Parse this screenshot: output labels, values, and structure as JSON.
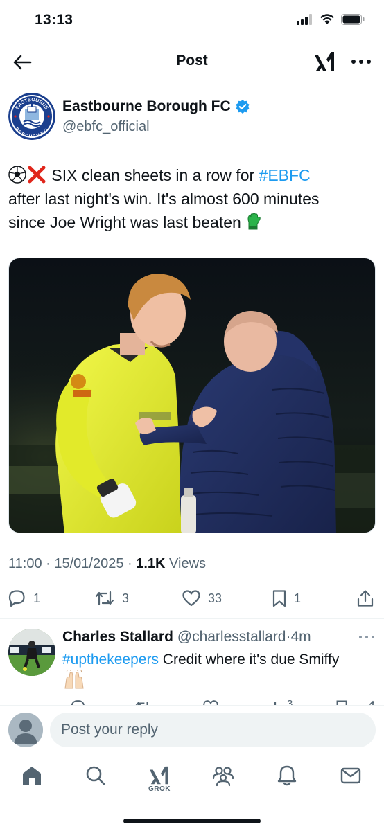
{
  "status_bar": {
    "time": "13:13"
  },
  "header": {
    "title": "Post",
    "icons": [
      "back-arrow-icon",
      "xai-logo-icon",
      "more-icon"
    ]
  },
  "post": {
    "author": {
      "name": "Eastbourne Borough FC",
      "handle": "@ebfc_official",
      "verified": true,
      "avatar_logo_text": [
        "EASTBOURNE",
        "BOROUGH F.C."
      ]
    },
    "text": {
      "line1_prefix": " SIX clean sheets in a row for ",
      "hashtag": "#EBFC",
      "line2": "after last night's win. It's almost 600 minutes",
      "line3": "since Joe Wright was last beaten "
    },
    "emojis": [
      "soccer-ball",
      "cross-mark",
      "goalkeeper-glove"
    ],
    "timestamp": "11:00 · 15/01/2025 · ",
    "views_count": "1.1K",
    "views_label": " Views",
    "actions": {
      "replies": "1",
      "reposts": "3",
      "likes": "33",
      "bookmarks": "1"
    }
  },
  "reply": {
    "name": "Charles Stallard",
    "handle": "@charlesstallard",
    "time": "·4m",
    "hashtag": "#upthekeepers",
    "text": " Credit where it's due Smiffy",
    "emoji": "raising-hands",
    "actions_partial": {
      "views": "3"
    }
  },
  "composer": {
    "placeholder": "Post your reply"
  },
  "tabbar": {
    "items": [
      {
        "icon": "home-icon"
      },
      {
        "icon": "search-icon"
      },
      {
        "icon": "grok-icon",
        "label": "GROK"
      },
      {
        "icon": "communities-icon"
      },
      {
        "icon": "notifications-icon"
      },
      {
        "icon": "messages-icon"
      }
    ]
  },
  "colors": {
    "accent": "#1d9bf0",
    "text_primary": "#0f1419",
    "text_secondary": "#536471",
    "goalkeeper_kit": "#e6f035",
    "coach_jacket": "#1f2d5c"
  }
}
